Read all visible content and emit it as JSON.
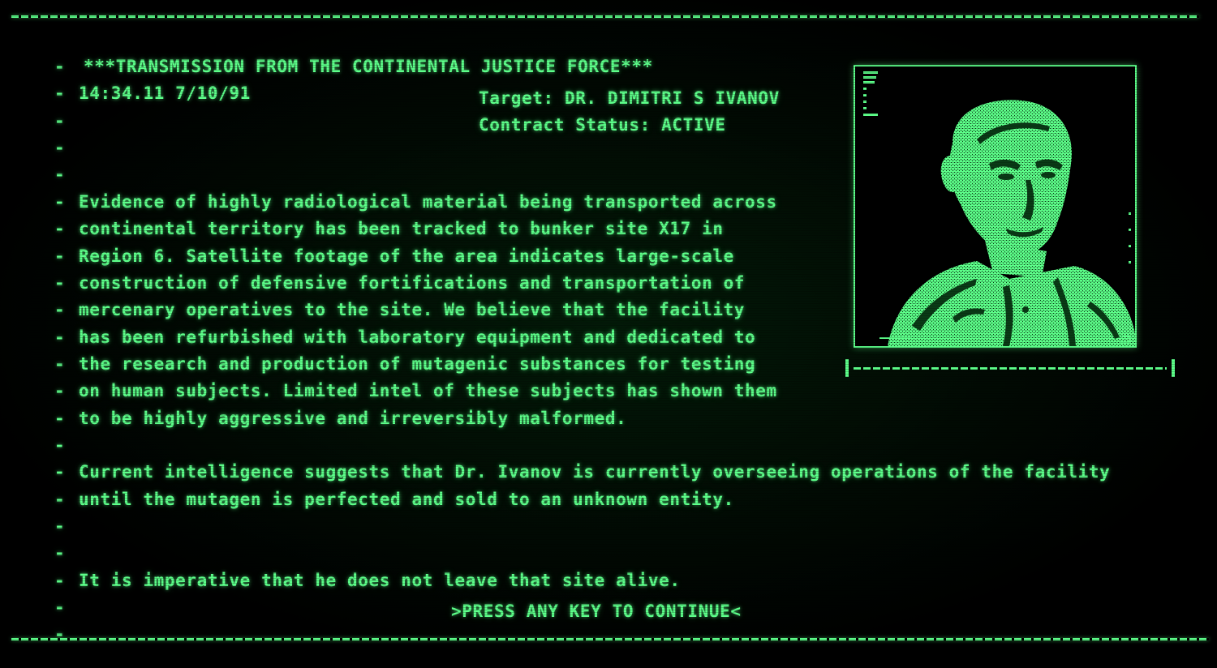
{
  "colors": {
    "phosphor": "#5dff8a",
    "background": "#000000"
  },
  "header": {
    "title": "***TRANSMISSION FROM THE CONTINENTAL JUSTICE FORCE***",
    "timestamp": "14:34.11 7/10/91"
  },
  "target": {
    "name_line": "Target: DR. DIMITRI S IVANOV",
    "status_line": "Contract Status: ACTIVE"
  },
  "body": {
    "paragraph1": [
      "Evidence of highly radiological material being transported across",
      "continental territory has been tracked to bunker site X17 in",
      "Region 6. Satellite footage of the area indicates large-scale",
      "construction of defensive fortifications and transportation of",
      "mercenary operatives to the site. We believe that the facility",
      "has been refurbished with laboratory equipment and dedicated to",
      "the research and production of mutagenic substances for testing",
      "on human subjects. Limited intel of these subjects has shown them",
      "to be highly aggressive and irreversibly malformed."
    ],
    "paragraph2": [
      "Current intelligence suggests that Dr. Ivanov is currently overseeing operations of the facility",
      "until the mutagen is perfected and sold to an unknown entity."
    ],
    "paragraph3": "It is imperative that he does not leave that site alive."
  },
  "line_marker": "-",
  "prompt": ">PRESS ANY KEY TO CONTINUE<",
  "portrait": {
    "icon": "target-portrait-icon"
  }
}
